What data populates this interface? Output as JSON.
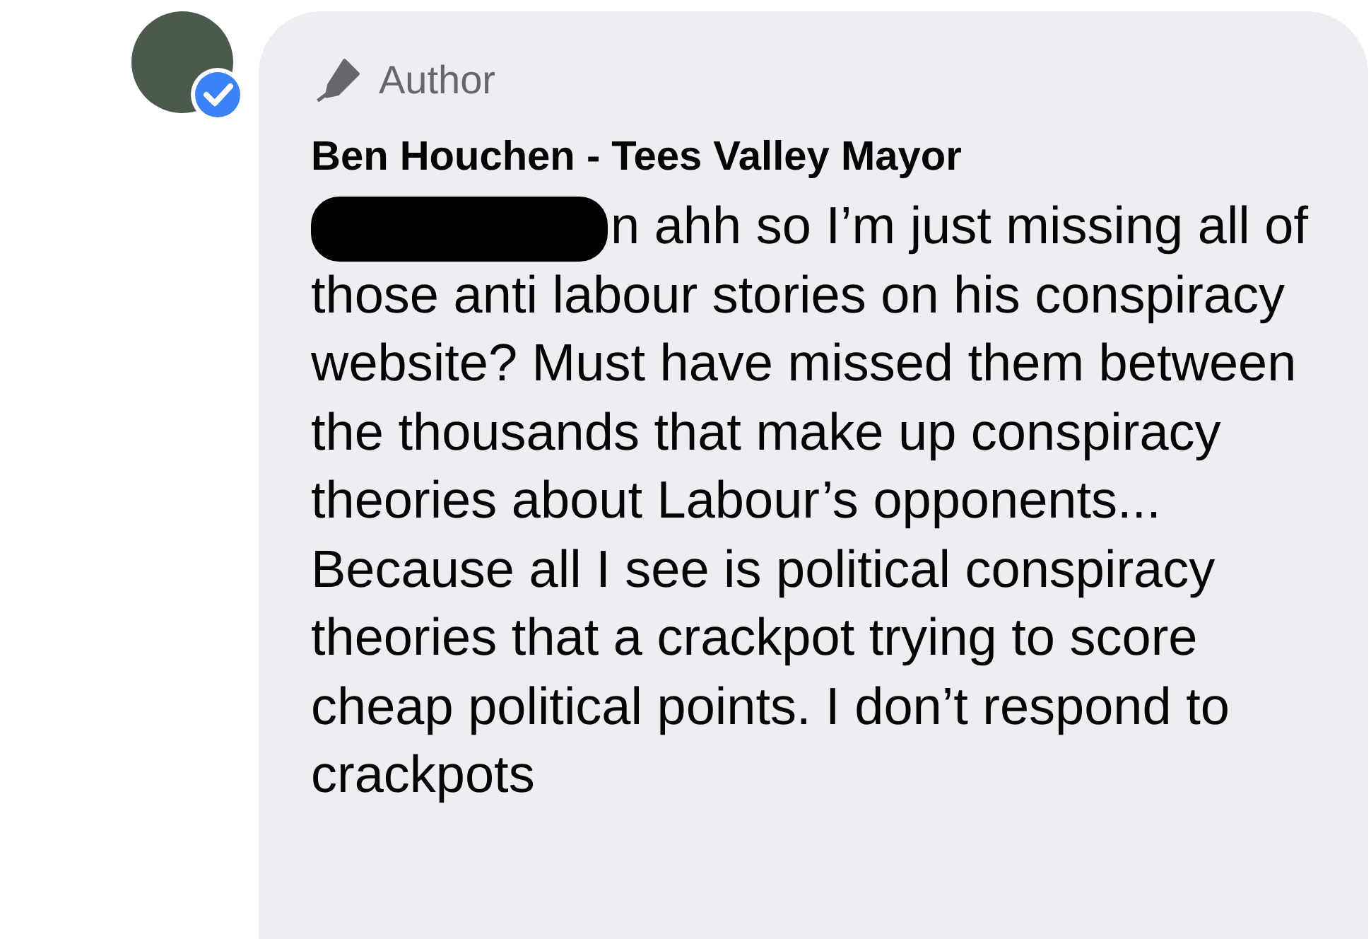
{
  "comment": {
    "badge": "Author",
    "author": "Ben Houchen - Tees Valley Mayor",
    "redacted": true,
    "paragraphs": [
      "n ahh so I’m just missing all of those anti labour stories on his conspiracy website? Must have missed them between the thousands that make up conspiracy theories about Labour’s opponents...",
      "Because all I see is political conspiracy theories that a crackpot trying to score cheap political points. I don’t respond to crackpots"
    ],
    "verified": true
  }
}
